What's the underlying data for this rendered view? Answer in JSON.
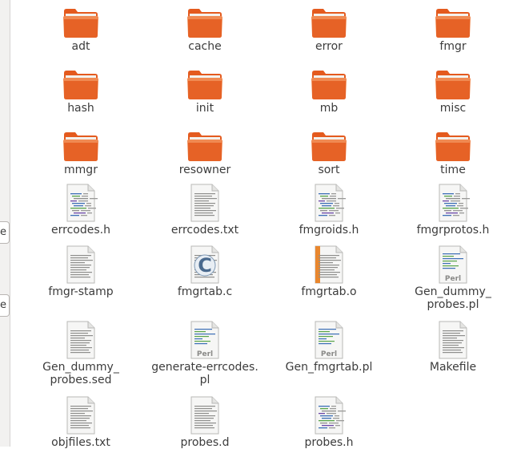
{
  "sidebar": {
    "tab_glyph": "e"
  },
  "files": [
    {
      "name": "adt",
      "type": "folder"
    },
    {
      "name": "cache",
      "type": "folder"
    },
    {
      "name": "error",
      "type": "folder"
    },
    {
      "name": "fmgr",
      "type": "folder"
    },
    {
      "name": "hash",
      "type": "folder"
    },
    {
      "name": "init",
      "type": "folder"
    },
    {
      "name": "mb",
      "type": "folder"
    },
    {
      "name": "misc",
      "type": "folder"
    },
    {
      "name": "mmgr",
      "type": "folder"
    },
    {
      "name": "resowner",
      "type": "folder"
    },
    {
      "name": "sort",
      "type": "folder"
    },
    {
      "name": "time",
      "type": "folder"
    },
    {
      "name": "errcodes.h",
      "type": "code"
    },
    {
      "name": "errcodes.txt",
      "type": "text"
    },
    {
      "name": "fmgroids.h",
      "type": "code"
    },
    {
      "name": "fmgrprotos.h",
      "type": "code"
    },
    {
      "name": "fmgr-stamp",
      "type": "text"
    },
    {
      "name": "fmgrtab.c",
      "type": "c-source"
    },
    {
      "name": "fmgrtab.o",
      "type": "object"
    },
    {
      "name": "Gen_dummy_\nprobes.pl",
      "type": "perl"
    },
    {
      "name": "Gen_dummy_\nprobes.sed",
      "type": "text"
    },
    {
      "name": "generate-errcodes.\npl",
      "type": "perl"
    },
    {
      "name": "Gen_fmgrtab.pl",
      "type": "perl"
    },
    {
      "name": "Makefile",
      "type": "text"
    },
    {
      "name": "objfiles.txt",
      "type": "text"
    },
    {
      "name": "probes.d",
      "type": "text"
    },
    {
      "name": "probes.h",
      "type": "code"
    }
  ],
  "icon_labels": {
    "perl": "Perl"
  },
  "colors": {
    "folder_body": "#e45a1e",
    "folder_top": "#f08a52",
    "accent": "#dd4814"
  }
}
